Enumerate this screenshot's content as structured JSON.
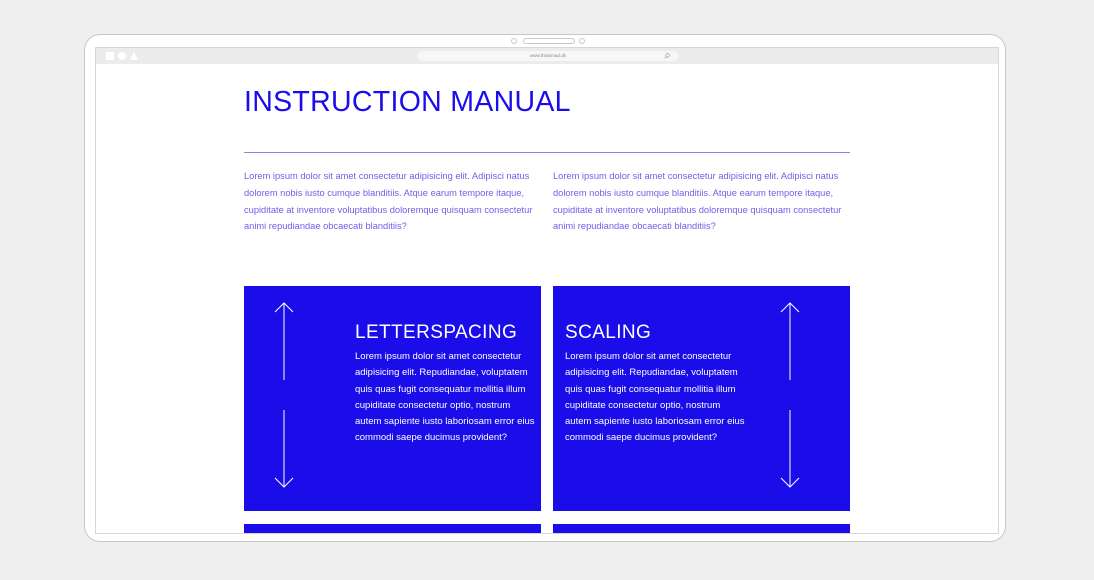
{
  "browser": {
    "url": "www.thisismad.dk"
  },
  "page": {
    "title": "INSTRUCTION MANUAL",
    "intro_left": "Lorem ipsum dolor sit amet consectetur adipisicing elit. Adipisci natus dolorem nobis iusto cumque blanditiis. Atque earum tempore itaque, cupiditate at inventore voluptatibus doloremque quisquam consectetur animi repudiandae obcaecati blanditiis?",
    "intro_right": "Lorem ipsum dolor sit amet consectetur adipisicing elit. Adipisci natus dolorem nobis iusto cumque blanditiis. Atque earum tempore itaque, cupiditate at inventore voluptatibus doloremque quisquam consectetur animi repudiandae obcaecati blanditiis?"
  },
  "cards": [
    {
      "title": "LETTERSPACING",
      "body": "Lorem ipsum dolor sit amet consectetur adipisicing elit. Repudiandae, voluptatem quis quas fugit consequatur mollitia illum cupiditate consectetur optio, nostrum autem sapiente iusto laboriosam error eius commodi saepe ducimus provident?"
    },
    {
      "title": "SCALING",
      "body": "Lorem ipsum dolor sit amet consectetur adipisicing elit. Repudiandae, voluptatem quis quas fugit consequatur mollitia illum cupiditate consectetur optio, nostrum autem sapiente iusto laboriosam error eius commodi saepe ducimus provident?"
    }
  ],
  "icons": {
    "window_controls": [
      "square-icon",
      "circle-icon",
      "triangle-icon"
    ],
    "search": "search-icon",
    "arrows": "vertical-double-arrow-icon"
  },
  "colors": {
    "accent": "#1a0dea",
    "intro_text": "#6f5fe6",
    "rule": "#8a84ef",
    "background": "#efefef"
  }
}
